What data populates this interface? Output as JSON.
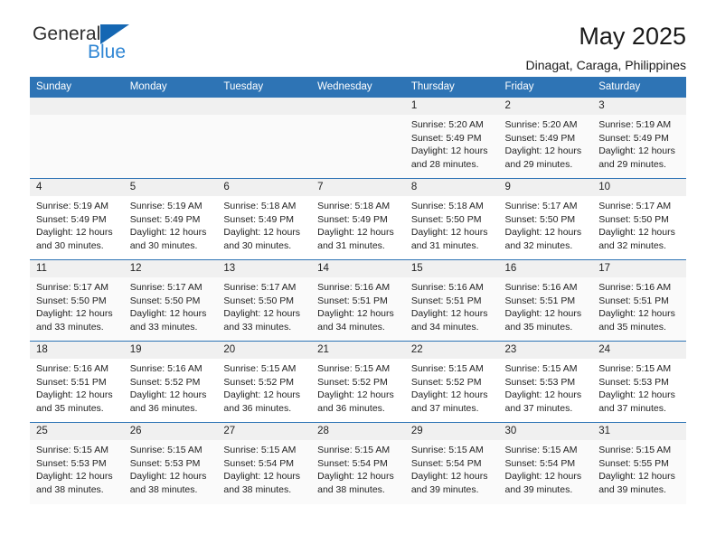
{
  "brand": {
    "name_top": "General",
    "name_bottom": "Blue",
    "accent_color": "#2f86d4",
    "triangle_color": "#1567b3"
  },
  "header": {
    "title": "May 2025",
    "subtitle": "Dinagat, Caraga, Philippines"
  },
  "calendar": {
    "header_bg": "#2e74b5",
    "header_text_color": "#ffffff",
    "weekdays": [
      "Sunday",
      "Monday",
      "Tuesday",
      "Wednesday",
      "Thursday",
      "Friday",
      "Saturday"
    ],
    "labels": {
      "sunrise": "Sunrise:",
      "sunset": "Sunset:",
      "daylight": "Daylight:"
    },
    "weeks": [
      [
        {
          "day": ""
        },
        {
          "day": ""
        },
        {
          "day": ""
        },
        {
          "day": ""
        },
        {
          "day": "1",
          "sunrise": "Sunrise: 5:20 AM",
          "sunset": "Sunset: 5:49 PM",
          "daylight": "Daylight: 12 hours and 28 minutes."
        },
        {
          "day": "2",
          "sunrise": "Sunrise: 5:20 AM",
          "sunset": "Sunset: 5:49 PM",
          "daylight": "Daylight: 12 hours and 29 minutes."
        },
        {
          "day": "3",
          "sunrise": "Sunrise: 5:19 AM",
          "sunset": "Sunset: 5:49 PM",
          "daylight": "Daylight: 12 hours and 29 minutes."
        }
      ],
      [
        {
          "day": "4",
          "sunrise": "Sunrise: 5:19 AM",
          "sunset": "Sunset: 5:49 PM",
          "daylight": "Daylight: 12 hours and 30 minutes."
        },
        {
          "day": "5",
          "sunrise": "Sunrise: 5:19 AM",
          "sunset": "Sunset: 5:49 PM",
          "daylight": "Daylight: 12 hours and 30 minutes."
        },
        {
          "day": "6",
          "sunrise": "Sunrise: 5:18 AM",
          "sunset": "Sunset: 5:49 PM",
          "daylight": "Daylight: 12 hours and 30 minutes."
        },
        {
          "day": "7",
          "sunrise": "Sunrise: 5:18 AM",
          "sunset": "Sunset: 5:49 PM",
          "daylight": "Daylight: 12 hours and 31 minutes."
        },
        {
          "day": "8",
          "sunrise": "Sunrise: 5:18 AM",
          "sunset": "Sunset: 5:50 PM",
          "daylight": "Daylight: 12 hours and 31 minutes."
        },
        {
          "day": "9",
          "sunrise": "Sunrise: 5:17 AM",
          "sunset": "Sunset: 5:50 PM",
          "daylight": "Daylight: 12 hours and 32 minutes."
        },
        {
          "day": "10",
          "sunrise": "Sunrise: 5:17 AM",
          "sunset": "Sunset: 5:50 PM",
          "daylight": "Daylight: 12 hours and 32 minutes."
        }
      ],
      [
        {
          "day": "11",
          "sunrise": "Sunrise: 5:17 AM",
          "sunset": "Sunset: 5:50 PM",
          "daylight": "Daylight: 12 hours and 33 minutes."
        },
        {
          "day": "12",
          "sunrise": "Sunrise: 5:17 AM",
          "sunset": "Sunset: 5:50 PM",
          "daylight": "Daylight: 12 hours and 33 minutes."
        },
        {
          "day": "13",
          "sunrise": "Sunrise: 5:17 AM",
          "sunset": "Sunset: 5:50 PM",
          "daylight": "Daylight: 12 hours and 33 minutes."
        },
        {
          "day": "14",
          "sunrise": "Sunrise: 5:16 AM",
          "sunset": "Sunset: 5:51 PM",
          "daylight": "Daylight: 12 hours and 34 minutes."
        },
        {
          "day": "15",
          "sunrise": "Sunrise: 5:16 AM",
          "sunset": "Sunset: 5:51 PM",
          "daylight": "Daylight: 12 hours and 34 minutes."
        },
        {
          "day": "16",
          "sunrise": "Sunrise: 5:16 AM",
          "sunset": "Sunset: 5:51 PM",
          "daylight": "Daylight: 12 hours and 35 minutes."
        },
        {
          "day": "17",
          "sunrise": "Sunrise: 5:16 AM",
          "sunset": "Sunset: 5:51 PM",
          "daylight": "Daylight: 12 hours and 35 minutes."
        }
      ],
      [
        {
          "day": "18",
          "sunrise": "Sunrise: 5:16 AM",
          "sunset": "Sunset: 5:51 PM",
          "daylight": "Daylight: 12 hours and 35 minutes."
        },
        {
          "day": "19",
          "sunrise": "Sunrise: 5:16 AM",
          "sunset": "Sunset: 5:52 PM",
          "daylight": "Daylight: 12 hours and 36 minutes."
        },
        {
          "day": "20",
          "sunrise": "Sunrise: 5:15 AM",
          "sunset": "Sunset: 5:52 PM",
          "daylight": "Daylight: 12 hours and 36 minutes."
        },
        {
          "day": "21",
          "sunrise": "Sunrise: 5:15 AM",
          "sunset": "Sunset: 5:52 PM",
          "daylight": "Daylight: 12 hours and 36 minutes."
        },
        {
          "day": "22",
          "sunrise": "Sunrise: 5:15 AM",
          "sunset": "Sunset: 5:52 PM",
          "daylight": "Daylight: 12 hours and 37 minutes."
        },
        {
          "day": "23",
          "sunrise": "Sunrise: 5:15 AM",
          "sunset": "Sunset: 5:53 PM",
          "daylight": "Daylight: 12 hours and 37 minutes."
        },
        {
          "day": "24",
          "sunrise": "Sunrise: 5:15 AM",
          "sunset": "Sunset: 5:53 PM",
          "daylight": "Daylight: 12 hours and 37 minutes."
        }
      ],
      [
        {
          "day": "25",
          "sunrise": "Sunrise: 5:15 AM",
          "sunset": "Sunset: 5:53 PM",
          "daylight": "Daylight: 12 hours and 38 minutes."
        },
        {
          "day": "26",
          "sunrise": "Sunrise: 5:15 AM",
          "sunset": "Sunset: 5:53 PM",
          "daylight": "Daylight: 12 hours and 38 minutes."
        },
        {
          "day": "27",
          "sunrise": "Sunrise: 5:15 AM",
          "sunset": "Sunset: 5:54 PM",
          "daylight": "Daylight: 12 hours and 38 minutes."
        },
        {
          "day": "28",
          "sunrise": "Sunrise: 5:15 AM",
          "sunset": "Sunset: 5:54 PM",
          "daylight": "Daylight: 12 hours and 38 minutes."
        },
        {
          "day": "29",
          "sunrise": "Sunrise: 5:15 AM",
          "sunset": "Sunset: 5:54 PM",
          "daylight": "Daylight: 12 hours and 39 minutes."
        },
        {
          "day": "30",
          "sunrise": "Sunrise: 5:15 AM",
          "sunset": "Sunset: 5:54 PM",
          "daylight": "Daylight: 12 hours and 39 minutes."
        },
        {
          "day": "31",
          "sunrise": "Sunrise: 5:15 AM",
          "sunset": "Sunset: 5:55 PM",
          "daylight": "Daylight: 12 hours and 39 minutes."
        }
      ]
    ]
  }
}
